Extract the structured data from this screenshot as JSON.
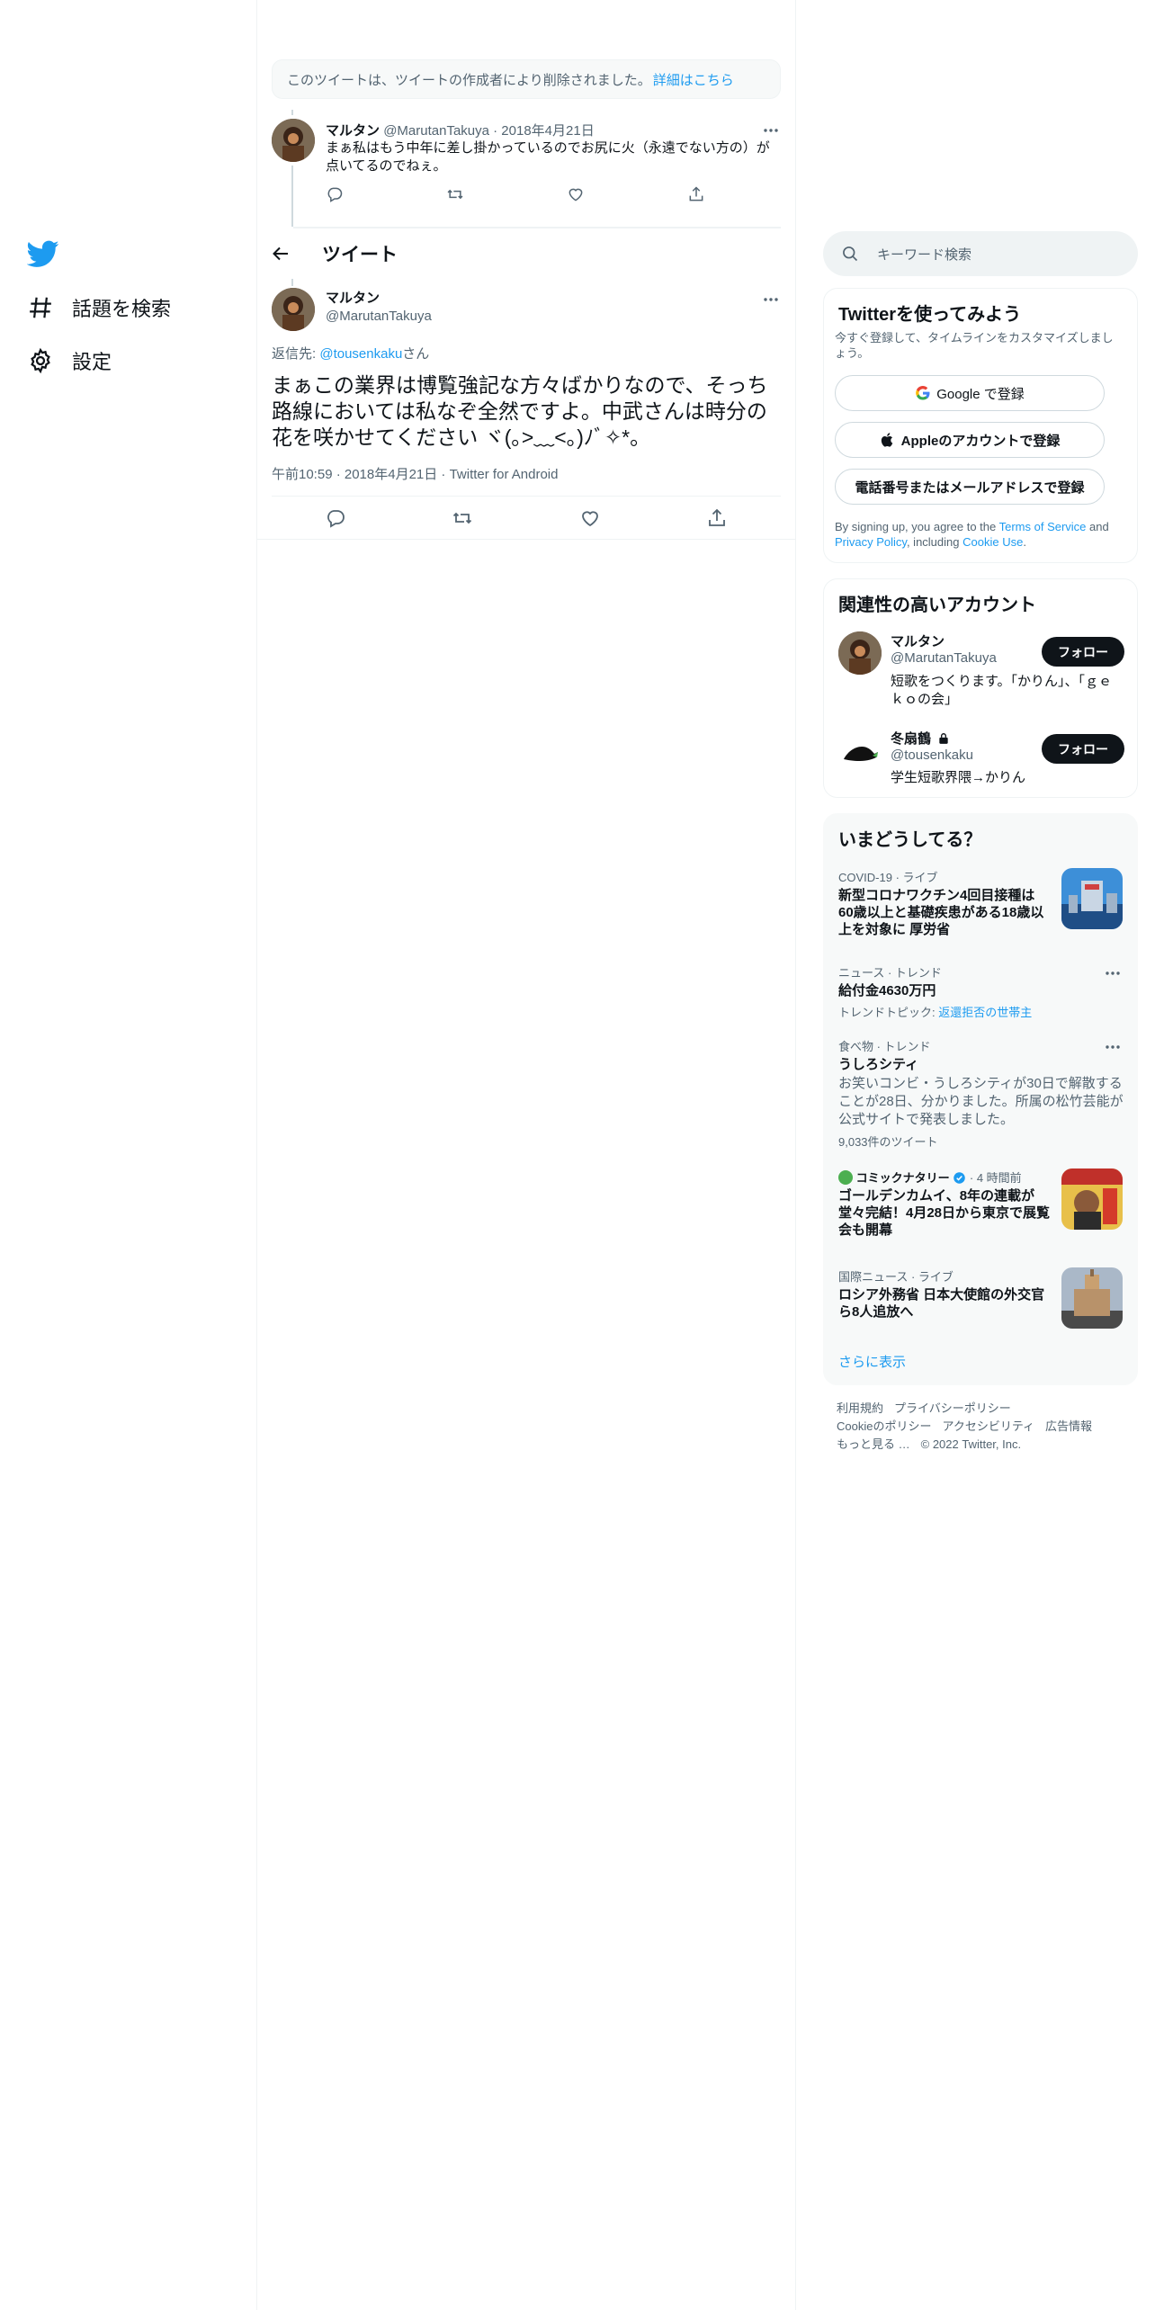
{
  "nav": {
    "explore_label": "話題を検索",
    "settings_label": "設定"
  },
  "deleted_notice": {
    "text": "このツイートは、ツイートの作成者により削除されました。",
    "link": "詳細はこちら"
  },
  "parent_tweet": {
    "name": "マルタン",
    "handle": "@MarutanTakuya",
    "date": "· 2018年4月21日",
    "text": "まぁ私はもう中年に差し掛かっているのでお尻に火（永遠でない方の）が点いてるのでねぇ。"
  },
  "header": {
    "title": "ツイート"
  },
  "main_tweet": {
    "name": "マルタン",
    "handle": "@MarutanTakuya",
    "reply_prefix": "返信先: ",
    "reply_mention": "@tousenkaku",
    "reply_suffix": "さん",
    "text": "まぁこの業界は博覧強記な方々ばかりなので、そっち路線においては私なぞ全然ですよ。中武さんは時分の花を咲かせてください ヾ(｡>﹏<｡)ﾉﾞ✧*。",
    "time": "午前10:59 · 2018年4月21日 · ",
    "client": "Twitter for Android"
  },
  "search": {
    "placeholder": "キーワード検索"
  },
  "signup": {
    "title": "Twitterを使ってみよう",
    "subtitle": "今すぐ登録して、タイムラインをカスタマイズしましょう。",
    "google_label": "Google で登録",
    "apple_label": "Appleのアカウントで登録",
    "phone_label": "電話番号またはメールアドレスで登録",
    "terms_prefix": "By signing up, you agree to the ",
    "terms_link": "Terms of Service",
    "terms_and": " and ",
    "privacy_link": "Privacy Policy",
    "terms_including": ", including ",
    "cookie_link": "Cookie Use",
    "terms_end": "."
  },
  "related": {
    "title": "関連性の高いアカウント",
    "users": [
      {
        "name": "マルタン",
        "handle": "@MarutanTakuya",
        "bio": "短歌をつくります。「かりん」、「ｇｅｋｏの会」",
        "follow_label": "フォロー"
      },
      {
        "name": "冬扇鶴",
        "handle": "@tousenkaku",
        "bio": "学生短歌界隈→かりん",
        "follow_label": "フォロー",
        "locked": true
      }
    ]
  },
  "trends": {
    "title": "いまどうしてる？",
    "items": [
      {
        "meta": "COVID-19 · ライブ",
        "title": "新型コロナワクチン4回目接種は60歳以上と基礎疾患がある18歳以上を対象に 厚労省"
      },
      {
        "meta": "ニュース · トレンド",
        "title": "給付金4630万円",
        "topic_prefix": "トレンドトピック: ",
        "topic_link": "返還拒否の世帯主"
      },
      {
        "meta": "食べ物 · トレンド",
        "title": "うしろシティ",
        "desc": "お笑いコンビ・うしろシティが30日で解散することが28日、分かりました。所属の松竹芸能が公式サイトで発表しました。",
        "count": "9,033件のツイート"
      },
      {
        "source": "コミックナタリー",
        "meta": " · 4 時間前",
        "title": "ゴールデンカムイ、8年の連載が堂々完結！4月28日から東京で展覧会も開幕"
      },
      {
        "meta": "国際ニュース · ライブ",
        "title": "ロシア外務省 日本大使館の外交官ら8人追放へ"
      }
    ],
    "show_more": "さらに表示"
  },
  "footer": {
    "terms": "利用規約",
    "privacy": "プライバシーポリシー",
    "cookie": "Cookieのポリシー",
    "accessibility": "アクセシビリティ",
    "ads": "広告情報",
    "more": "もっと見る …",
    "copyright": "© 2022 Twitter, Inc."
  },
  "colors": {
    "brand": "#1d9bf0",
    "text": "#0f1419",
    "muted": "#536471",
    "follow_button": "#0f1419"
  }
}
